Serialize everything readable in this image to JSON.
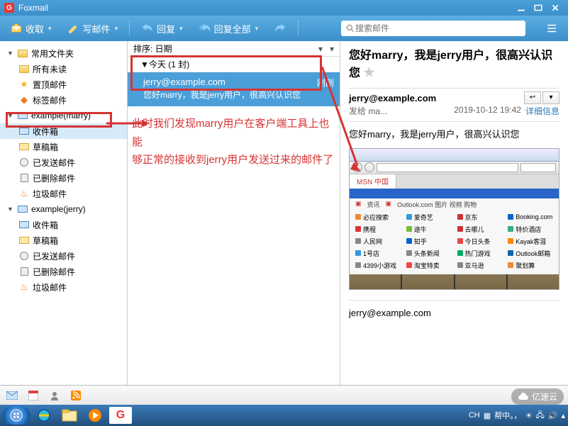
{
  "app": {
    "title": "Foxmail"
  },
  "toolbar": {
    "receive": "收取",
    "compose": "写邮件",
    "reply": "回复",
    "replyall": "回复全部",
    "search_placeholder": "搜索邮件"
  },
  "sidebar": {
    "common": {
      "label": "常用文件夹",
      "unread": "所有未读",
      "pinned": "置顶邮件",
      "tags": "标签邮件"
    },
    "acct1": {
      "label": "example(marry)",
      "inbox": "收件箱",
      "drafts": "草稿箱",
      "sent": "已发送邮件",
      "deleted": "已删除邮件",
      "spam": "垃圾邮件"
    },
    "acct2": {
      "label": "example(jerry)",
      "inbox": "收件箱",
      "drafts": "草稿箱",
      "sent": "已发送邮件",
      "deleted": "已删除邮件",
      "spam": "垃圾邮件"
    }
  },
  "list": {
    "sort_label": "排序: 日期",
    "group_today": "今天 (1 封)",
    "item": {
      "from": "jerry@example.com",
      "time": "刚刚",
      "subject": "您好marry，我是jerry用户，很高兴认识您"
    }
  },
  "annotation": {
    "line1": "此时我们发现marry用户在客户端工具上也能",
    "line2": "够正常的接收到jerry用户发送过来的邮件了"
  },
  "preview": {
    "title": "您好marry，我是jerry用户，很高兴认识您",
    "from": "jerry@example.com",
    "to_label": "发给 ma...",
    "date": "2019-10-12 19:42",
    "detail": "详细信息",
    "body": "您好marry，我是jerry用户，很高兴认识您",
    "footer": "jerry@example.com",
    "browser_tab": "MSN 中国"
  },
  "tray": {
    "ime": "CH",
    "status": "帮中。，"
  },
  "watermark": "亿速云"
}
